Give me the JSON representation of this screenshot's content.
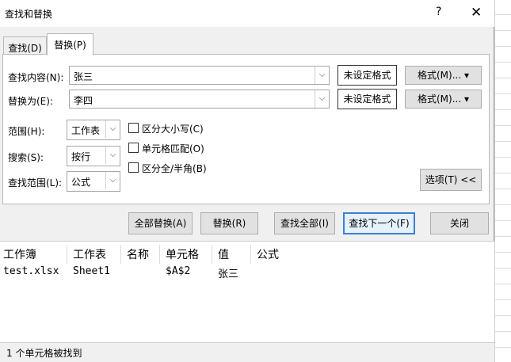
{
  "window": {
    "title": "查找和替换",
    "help": "?",
    "close": "✕"
  },
  "tabs": {
    "find": "查找(D)",
    "replace": "替换(P)"
  },
  "find": {
    "label": "查找内容(N):",
    "value": "张三",
    "format_status": "未设定格式",
    "format_button": "格式(M)..."
  },
  "replace": {
    "label": "替换为(E):",
    "value": "李四",
    "format_status": "未设定格式",
    "format_button": "格式(M)..."
  },
  "options": {
    "scope_label": "范围(H):",
    "scope_value": "工作表",
    "search_label": "搜索(S):",
    "search_value": "按行",
    "lookin_label": "查找范围(L):",
    "lookin_value": "公式",
    "match_case": "区分大小写(C)",
    "match_cell": "单元格匹配(O)",
    "match_width": "区分全/半角(B)",
    "options_button": "选项(T) <<"
  },
  "buttons": {
    "replace_all": "全部替换(A)",
    "replace": "替换(R)",
    "find_all": "查找全部(I)",
    "find_next": "查找下一个(F)",
    "close": "关闭"
  },
  "results": {
    "headers": [
      "工作簿",
      "工作表",
      "名称",
      "单元格",
      "值",
      "公式"
    ],
    "rows": [
      [
        "test.xlsx",
        "Sheet1",
        "",
        "$A$2",
        "张三",
        ""
      ]
    ]
  },
  "status": "1 个单元格被找到",
  "icons": {
    "dropdown": "▾",
    "combo_arrow": "⌵"
  }
}
